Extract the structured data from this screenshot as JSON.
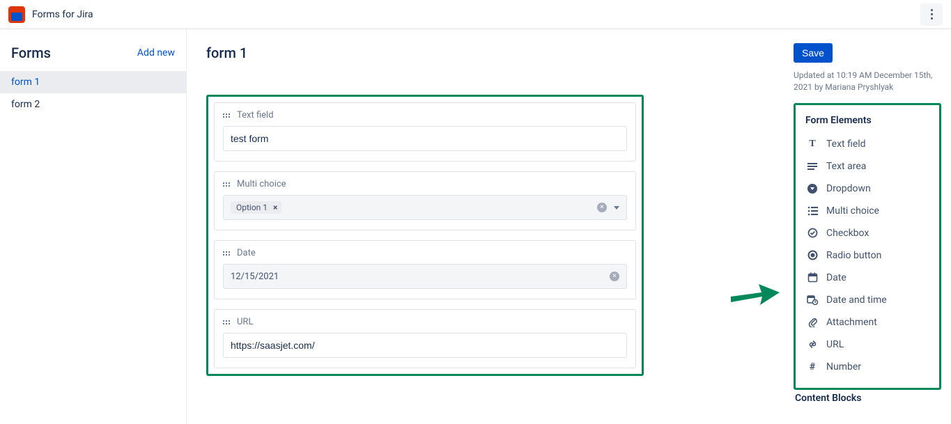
{
  "app": {
    "title": "Forms for Jira"
  },
  "sidebar": {
    "title": "Forms",
    "add_label": "Add new",
    "items": [
      {
        "label": "form 1",
        "active": true
      },
      {
        "label": "form 2",
        "active": false
      }
    ]
  },
  "editor": {
    "form_title": "form 1",
    "fields": [
      {
        "type": "text",
        "label": "Text field",
        "value": "test form"
      },
      {
        "type": "multi",
        "label": "Multi choice",
        "chip": "Option 1"
      },
      {
        "type": "date",
        "label": "Date",
        "value": "12/15/2021"
      },
      {
        "type": "url",
        "label": "URL",
        "value": "https://saasjet.com/"
      }
    ]
  },
  "right": {
    "save_label": "Save",
    "updated_text": "Updated at 10:19 AM December 15th, 2021 by Mariana Pryshlyak",
    "elements_title": "Form Elements",
    "elements": [
      {
        "icon": "text",
        "label": "Text field"
      },
      {
        "icon": "textarea",
        "label": "Text area"
      },
      {
        "icon": "dropdown",
        "label": "Dropdown"
      },
      {
        "icon": "multi",
        "label": "Multi choice"
      },
      {
        "icon": "checkbox",
        "label": "Checkbox"
      },
      {
        "icon": "radio",
        "label": "Radio button"
      },
      {
        "icon": "date",
        "label": "Date"
      },
      {
        "icon": "datetime",
        "label": "Date and time"
      },
      {
        "icon": "attachment",
        "label": "Attachment"
      },
      {
        "icon": "url",
        "label": "URL"
      },
      {
        "icon": "number",
        "label": "Number"
      }
    ],
    "content_blocks_title": "Content Blocks"
  }
}
